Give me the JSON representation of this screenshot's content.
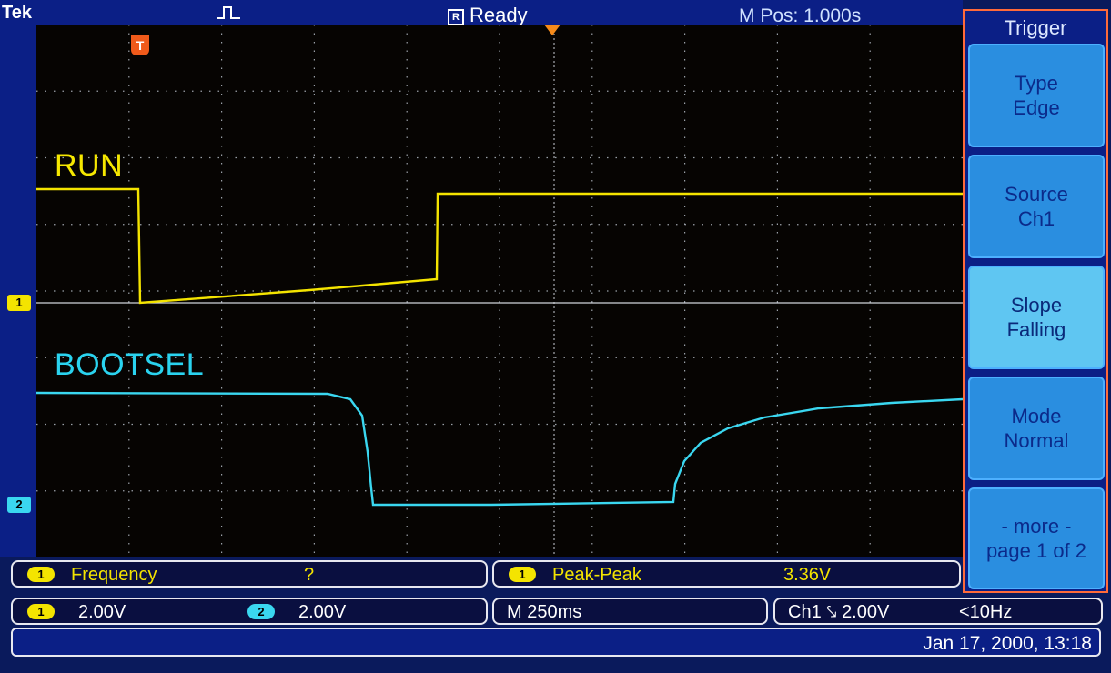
{
  "top": {
    "brand": "Tek",
    "status": "Ready",
    "status_icon": "R",
    "mpos": "M Pos: 1.000s"
  },
  "markers": {
    "trigger": "T",
    "ch1": "1",
    "ch2": "2"
  },
  "traces": {
    "run_label": "RUN",
    "bootsel_label": "BOOTSEL"
  },
  "menu": {
    "title": "Trigger",
    "buttons": [
      {
        "line1": "Type",
        "line2": "Edge"
      },
      {
        "line1": "Source",
        "line2": "Ch1"
      },
      {
        "line1": "Slope",
        "line2": "Falling"
      },
      {
        "line1": "Mode",
        "line2": "Normal"
      },
      {
        "line1": "- more -",
        "line2": "page 1 of 2"
      }
    ]
  },
  "measurements": {
    "m1": {
      "channel": "1",
      "name": "Frequency",
      "value": "?"
    },
    "m2": {
      "channel": "1",
      "name": "Peak-Peak",
      "value": "3.36V"
    }
  },
  "settings": {
    "ch1": {
      "channel": "1",
      "scale": "2.00V"
    },
    "ch2": {
      "channel": "2",
      "scale": "2.00V"
    },
    "timebase": "M 250ms",
    "trigger": "Ch1 ⤥ 2.00V",
    "trigger_freq": "<10Hz"
  },
  "datetime": "Jan 17, 2000, 13:18",
  "colors": {
    "ch1": "#f4e400",
    "ch2": "#3ad7f0",
    "trigger_marker": "#f05a1a",
    "menu_border": "#ff6a3a"
  }
}
